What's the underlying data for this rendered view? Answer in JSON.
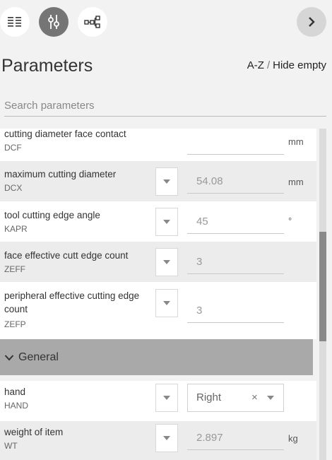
{
  "toolbar": {
    "icons": [
      "list-view-icon",
      "sliders-icon",
      "hierarchy-icon",
      "chevron-right-icon"
    ]
  },
  "header": {
    "title": "Parameters",
    "sort_az": "A-Z",
    "separator": "/",
    "hide_empty": "Hide empty"
  },
  "search": {
    "placeholder": "Search parameters",
    "value": ""
  },
  "params": [
    {
      "name": "cutting diameter face contact",
      "code": "DCF",
      "value": "",
      "unit": "mm"
    },
    {
      "name": "maximum cutting diameter",
      "code": "DCX",
      "value": "54.08",
      "unit": "mm"
    },
    {
      "name": "tool cutting edge angle",
      "code": "KAPR",
      "value": "45",
      "unit": "°"
    },
    {
      "name": "face effective cutt edge count",
      "code": "ZEFF",
      "value": "3",
      "unit": ""
    },
    {
      "name": "peripheral effective cutting edge count",
      "code": "ZEFP",
      "value": "3",
      "unit": ""
    }
  ],
  "section": {
    "label": "General"
  },
  "general_params": [
    {
      "name": "hand",
      "code": "HAND",
      "value": "Right",
      "clear": "×"
    },
    {
      "name": "weight of item",
      "code": "WT",
      "value": "2.897",
      "unit": "kg"
    }
  ]
}
